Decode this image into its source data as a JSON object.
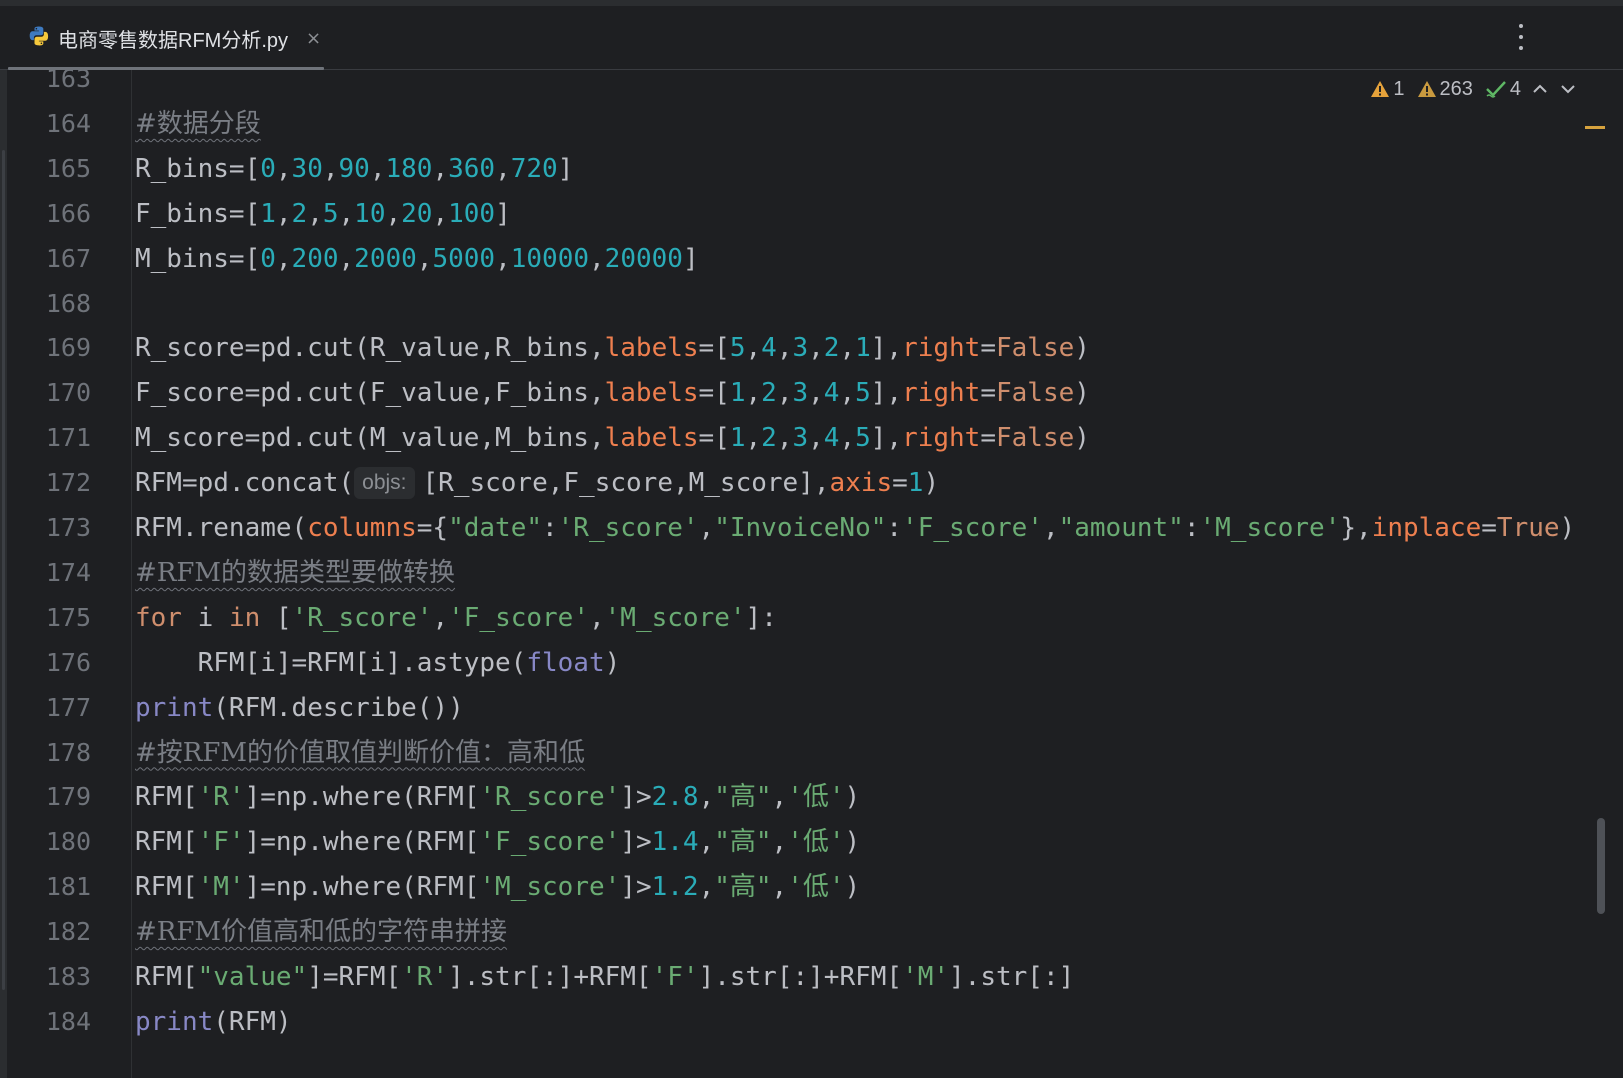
{
  "tab": {
    "title": "电商零售数据RFM分析.py",
    "icon": "python-icon",
    "close": "×"
  },
  "inspections": {
    "errors": "1",
    "warnings": "263",
    "typos": "4"
  },
  "lines": [
    {
      "n": "163",
      "seg": []
    },
    {
      "n": "164",
      "seg": [
        [
          "cmt",
          "#数据分段"
        ]
      ]
    },
    {
      "n": "165",
      "seg": [
        [
          "p",
          "R_bins=["
        ],
        [
          "num",
          "0"
        ],
        [
          "p",
          ","
        ],
        [
          "num",
          "30"
        ],
        [
          "p",
          ","
        ],
        [
          "num",
          "90"
        ],
        [
          "p",
          ","
        ],
        [
          "num",
          "180"
        ],
        [
          "p",
          ","
        ],
        [
          "num",
          "360"
        ],
        [
          "p",
          ","
        ],
        [
          "num",
          "720"
        ],
        [
          "p",
          "]"
        ]
      ]
    },
    {
      "n": "166",
      "seg": [
        [
          "p",
          "F_bins=["
        ],
        [
          "num",
          "1"
        ],
        [
          "p",
          ","
        ],
        [
          "num",
          "2"
        ],
        [
          "p",
          ","
        ],
        [
          "num",
          "5"
        ],
        [
          "p",
          ","
        ],
        [
          "num",
          "10"
        ],
        [
          "p",
          ","
        ],
        [
          "num",
          "20"
        ],
        [
          "p",
          ","
        ],
        [
          "num",
          "100"
        ],
        [
          "p",
          "]"
        ]
      ]
    },
    {
      "n": "167",
      "seg": [
        [
          "p",
          "M_bins=["
        ],
        [
          "num",
          "0"
        ],
        [
          "p",
          ","
        ],
        [
          "num",
          "200"
        ],
        [
          "p",
          ","
        ],
        [
          "num",
          "2000"
        ],
        [
          "p",
          ","
        ],
        [
          "num",
          "5000"
        ],
        [
          "p",
          ","
        ],
        [
          "num",
          "10000"
        ],
        [
          "p",
          ","
        ],
        [
          "num",
          "20000"
        ],
        [
          "p",
          "]"
        ]
      ]
    },
    {
      "n": "168",
      "seg": []
    },
    {
      "n": "169",
      "seg": [
        [
          "p",
          "R_score=pd.cut(R_value,R_bins,"
        ],
        [
          "param",
          "labels"
        ],
        [
          "p",
          "=["
        ],
        [
          "num",
          "5"
        ],
        [
          "p",
          ","
        ],
        [
          "num",
          "4"
        ],
        [
          "p",
          ","
        ],
        [
          "num",
          "3"
        ],
        [
          "p",
          ","
        ],
        [
          "num",
          "2"
        ],
        [
          "p",
          ","
        ],
        [
          "num",
          "1"
        ],
        [
          "p",
          "],"
        ],
        [
          "param",
          "right"
        ],
        [
          "p",
          "="
        ],
        [
          "kw",
          "False"
        ],
        [
          "p",
          ")"
        ]
      ]
    },
    {
      "n": "170",
      "seg": [
        [
          "p",
          "F_score=pd.cut(F_value,F_bins,"
        ],
        [
          "param",
          "labels"
        ],
        [
          "p",
          "=["
        ],
        [
          "num",
          "1"
        ],
        [
          "p",
          ","
        ],
        [
          "num",
          "2"
        ],
        [
          "p",
          ","
        ],
        [
          "num",
          "3"
        ],
        [
          "p",
          ","
        ],
        [
          "num",
          "4"
        ],
        [
          "p",
          ","
        ],
        [
          "num",
          "5"
        ],
        [
          "p",
          "],"
        ],
        [
          "param",
          "right"
        ],
        [
          "p",
          "="
        ],
        [
          "kw",
          "False"
        ],
        [
          "p",
          ")"
        ]
      ]
    },
    {
      "n": "171",
      "seg": [
        [
          "p",
          "M_score=pd.cut(M_value,M_bins,"
        ],
        [
          "param",
          "labels"
        ],
        [
          "p",
          "=["
        ],
        [
          "num",
          "1"
        ],
        [
          "p",
          ","
        ],
        [
          "num",
          "2"
        ],
        [
          "p",
          ","
        ],
        [
          "num",
          "3"
        ],
        [
          "p",
          ","
        ],
        [
          "num",
          "4"
        ],
        [
          "p",
          ","
        ],
        [
          "num",
          "5"
        ],
        [
          "p",
          "],"
        ],
        [
          "param",
          "right"
        ],
        [
          "p",
          "="
        ],
        [
          "kw",
          "False"
        ],
        [
          "p",
          ")"
        ]
      ]
    },
    {
      "n": "172",
      "seg": [
        [
          "p",
          "RFM=pd.concat("
        ],
        [
          "hint",
          "objs:"
        ],
        [
          "p",
          "[R_score,F_score,M_score],"
        ],
        [
          "param",
          "axis"
        ],
        [
          "p",
          "="
        ],
        [
          "num",
          "1"
        ],
        [
          "p",
          ")"
        ]
      ]
    },
    {
      "n": "173",
      "seg": [
        [
          "p",
          "RFM.rename("
        ],
        [
          "param",
          "columns"
        ],
        [
          "p",
          "={"
        ],
        [
          "str",
          "\"date\""
        ],
        [
          "p",
          ":"
        ],
        [
          "str",
          "'R_score'"
        ],
        [
          "p",
          ","
        ],
        [
          "str",
          "\"InvoiceNo\""
        ],
        [
          "p",
          ":"
        ],
        [
          "str",
          "'F_score'"
        ],
        [
          "p",
          ","
        ],
        [
          "str",
          "\"amount\""
        ],
        [
          "p",
          ":"
        ],
        [
          "str",
          "'M_score'"
        ],
        [
          "p",
          "},"
        ],
        [
          "param",
          "inplace"
        ],
        [
          "p",
          "="
        ],
        [
          "kw",
          "True"
        ],
        [
          "p",
          ")"
        ]
      ]
    },
    {
      "n": "174",
      "seg": [
        [
          "cmt",
          "#RFM的数据类型要做转换"
        ]
      ]
    },
    {
      "n": "175",
      "seg": [
        [
          "kw",
          "for"
        ],
        [
          "p",
          " i "
        ],
        [
          "kw",
          "in"
        ],
        [
          "p",
          " ["
        ],
        [
          "str",
          "'R_score'"
        ],
        [
          "p",
          ","
        ],
        [
          "str",
          "'F_score'"
        ],
        [
          "p",
          ","
        ],
        [
          "str",
          "'M_score'"
        ],
        [
          "p",
          "]:"
        ]
      ]
    },
    {
      "n": "176",
      "seg": [
        [
          "p",
          "    RFM[i]=RFM[i].astype("
        ],
        [
          "builtin",
          "float"
        ],
        [
          "p",
          ")"
        ]
      ]
    },
    {
      "n": "177",
      "seg": [
        [
          "builtin",
          "print"
        ],
        [
          "p",
          "(RFM.describe())"
        ]
      ]
    },
    {
      "n": "178",
      "seg": [
        [
          "cmt",
          "#按RFM的价值取值判断价值：高和低"
        ]
      ]
    },
    {
      "n": "179",
      "seg": [
        [
          "p",
          "RFM["
        ],
        [
          "str",
          "'R'"
        ],
        [
          "p",
          "]=np.where(RFM["
        ],
        [
          "str",
          "'R_score'"
        ],
        [
          "p",
          "]>"
        ],
        [
          "num",
          "2.8"
        ],
        [
          "p",
          ","
        ],
        [
          "str",
          "\"高\""
        ],
        [
          "p",
          ","
        ],
        [
          "str",
          "'低'"
        ],
        [
          "p",
          ")"
        ]
      ]
    },
    {
      "n": "180",
      "seg": [
        [
          "p",
          "RFM["
        ],
        [
          "str",
          "'F'"
        ],
        [
          "p",
          "]=np.where(RFM["
        ],
        [
          "str",
          "'F_score'"
        ],
        [
          "p",
          "]>"
        ],
        [
          "num",
          "1.4"
        ],
        [
          "p",
          ","
        ],
        [
          "str",
          "\"高\""
        ],
        [
          "p",
          ","
        ],
        [
          "str",
          "'低'"
        ],
        [
          "p",
          ")"
        ]
      ]
    },
    {
      "n": "181",
      "seg": [
        [
          "p",
          "RFM["
        ],
        [
          "str",
          "'M'"
        ],
        [
          "p",
          "]=np.where(RFM["
        ],
        [
          "str",
          "'M_score'"
        ],
        [
          "p",
          "]>"
        ],
        [
          "num",
          "1.2"
        ],
        [
          "p",
          ","
        ],
        [
          "str",
          "\"高\""
        ],
        [
          "p",
          ","
        ],
        [
          "str",
          "'低'"
        ],
        [
          "p",
          ")"
        ]
      ]
    },
    {
      "n": "182",
      "seg": [
        [
          "cmt",
          "#RFM价值高和低的字符串拼接"
        ]
      ]
    },
    {
      "n": "183",
      "seg": [
        [
          "p",
          "RFM["
        ],
        [
          "str",
          "\"value\""
        ],
        [
          "p",
          "]=RFM["
        ],
        [
          "str",
          "'R'"
        ],
        [
          "p",
          "].str[:]+RFM["
        ],
        [
          "str",
          "'F'"
        ],
        [
          "p",
          "].str[:]+RFM["
        ],
        [
          "str",
          "'M'"
        ],
        [
          "p",
          "].str[:]"
        ]
      ]
    },
    {
      "n": "184",
      "seg": [
        [
          "builtin",
          "print"
        ],
        [
          "p",
          "(RFM)"
        ]
      ]
    }
  ]
}
